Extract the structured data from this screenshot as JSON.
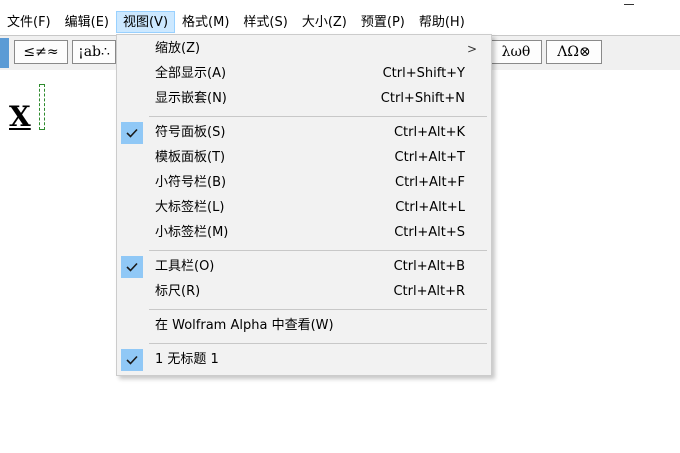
{
  "menubar": {
    "items": [
      "文件(F)",
      "编辑(E)",
      "视图(V)",
      "格式(M)",
      "样式(S)",
      "大小(Z)",
      "预置(P)",
      "帮助(H)"
    ],
    "active_index": 2
  },
  "toolbar": {
    "buttons": [
      "≤≠≈",
      "¡ab∴",
      "λωθ",
      "ΛΩ⊗"
    ]
  },
  "document": {
    "math_text": "X"
  },
  "view_menu": {
    "items": [
      {
        "label": "缩放(Z)",
        "shortcut": "",
        "submenu": true,
        "checked": false
      },
      {
        "label": "全部显示(A)",
        "shortcut": "Ctrl+Shift+Y",
        "checked": false
      },
      {
        "label": "显示嵌套(N)",
        "shortcut": "Ctrl+Shift+N",
        "checked": false
      },
      {
        "label": "符号面板(S)",
        "shortcut": "Ctrl+Alt+K",
        "checked": true
      },
      {
        "label": "模板面板(T)",
        "shortcut": "Ctrl+Alt+T",
        "checked": false
      },
      {
        "label": "小符号栏(B)",
        "shortcut": "Ctrl+Alt+F",
        "checked": false
      },
      {
        "label": "大标签栏(L)",
        "shortcut": "Ctrl+Alt+L",
        "checked": false
      },
      {
        "label": "小标签栏(M)",
        "shortcut": "Ctrl+Alt+S",
        "checked": false
      },
      {
        "label": "工具栏(O)",
        "shortcut": "Ctrl+Alt+B",
        "checked": true
      },
      {
        "label": "标尺(R)",
        "shortcut": "Ctrl+Alt+R",
        "checked": false
      },
      {
        "label": "在 Wolfram Alpha 中查看(W)",
        "shortcut": "",
        "checked": false
      },
      {
        "label": "1 无标题 1",
        "shortcut": "",
        "checked": true
      }
    ]
  },
  "colors": {
    "menu_active_bg": "#cce8ff",
    "check_bg": "#90c8f6",
    "dropdown_bg": "#f2f2f2"
  }
}
